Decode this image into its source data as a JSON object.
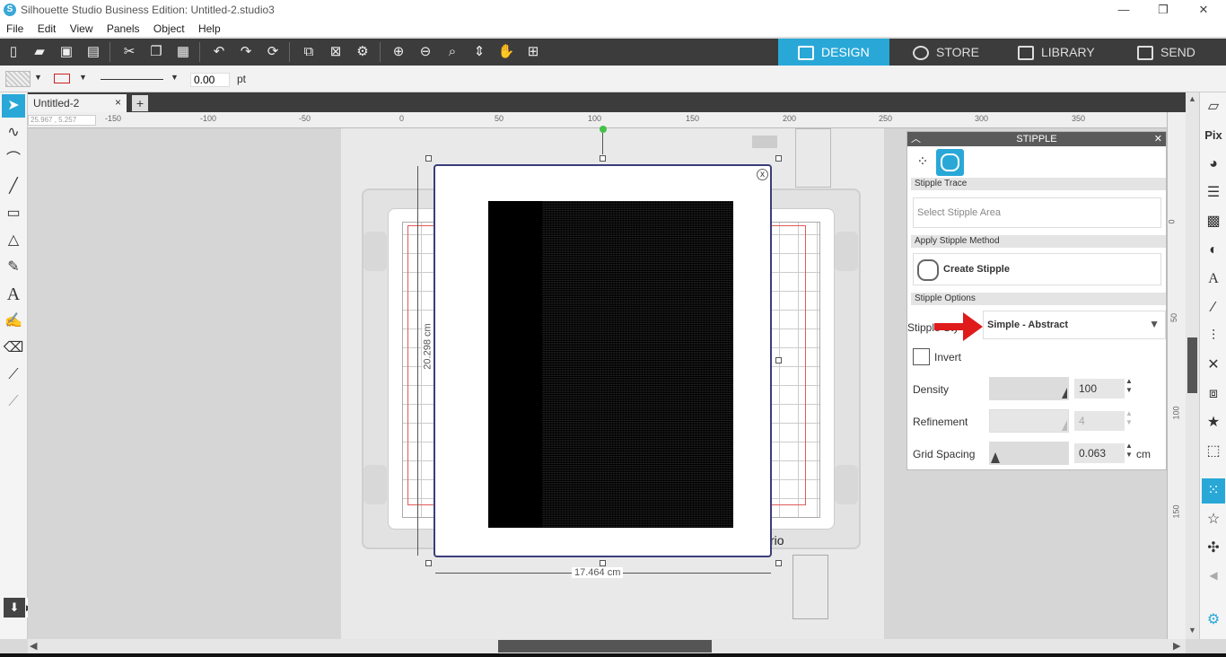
{
  "app": {
    "title": "Silhouette Studio Business Edition: Untitled-2.studio3",
    "logo_letter": "S"
  },
  "window_controls": {
    "minimize": "—",
    "restore": "❐",
    "close": "✕"
  },
  "menu": [
    "File",
    "Edit",
    "View",
    "Panels",
    "Object",
    "Help"
  ],
  "nav_tabs": [
    {
      "label": "DESIGN",
      "active": true
    },
    {
      "label": "STORE",
      "active": false
    },
    {
      "label": "LIBRARY",
      "active": false
    },
    {
      "label": "SEND",
      "active": false
    }
  ],
  "line_props": {
    "width_value": "0.00",
    "unit": "pt",
    "line_color": "#cc2222"
  },
  "doc_tabs": {
    "active": "Untitled-2",
    "close": "×",
    "add": "+"
  },
  "coords_readout": "25.967 , 5.257",
  "hruler_ticks": [
    "-150",
    "-100",
    "-50",
    "0",
    "50",
    "100",
    "150",
    "200",
    "250",
    "300",
    "350"
  ],
  "vruler_ticks": [
    "0",
    "50",
    "100",
    "150"
  ],
  "dimensions": {
    "width": "17.464 cm",
    "height": "20.298 cm"
  },
  "page_close": "x",
  "mat_label_fragment": "rio",
  "stipple_panel": {
    "title": "STIPPLE",
    "section_trace": "Stipple Trace",
    "select_area_label": "Select Stipple Area",
    "section_method": "Apply Stipple Method",
    "create_label": "Create Stipple",
    "section_options": "Stipple Options",
    "style_label": "Stipple Sty",
    "style_value": "Simple - Abstract",
    "invert_label": "Invert",
    "invert_checked": false,
    "density_label": "Density",
    "density_value": "100",
    "refinement_label": "Refinement",
    "refinement_value": "4",
    "grid_label": "Grid Spacing",
    "grid_value": "0.063",
    "grid_unit": "cm"
  },
  "colors": {
    "accent": "#29a8d8",
    "toolbar_bg": "#3c3c3c",
    "arrow": "#e01b1b",
    "page_border": "#3b3d7a"
  }
}
